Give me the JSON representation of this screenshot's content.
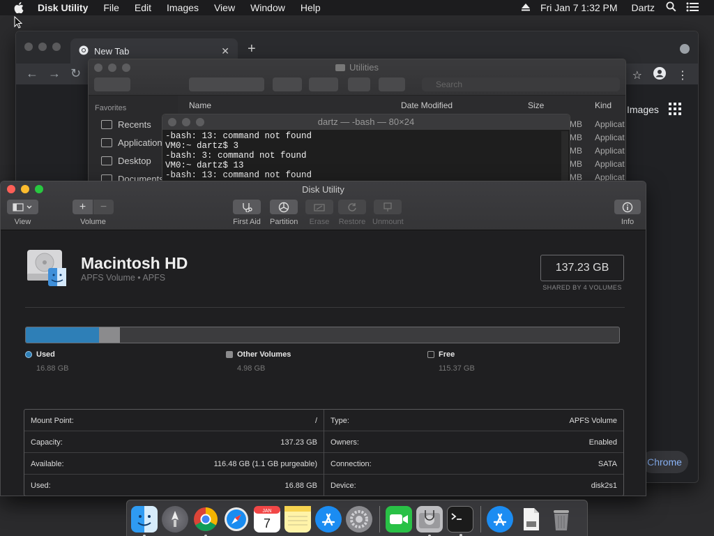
{
  "menubar": {
    "app_name": "Disk Utility",
    "menus": [
      "File",
      "Edit",
      "Images",
      "View",
      "Window",
      "Help"
    ],
    "clock": "Fri Jan 7  1:32 PM",
    "user": "Dartz"
  },
  "chrome": {
    "tab_title": "New Tab",
    "images_link": "Images",
    "chrome_pill": "Chrome"
  },
  "finder": {
    "title": "Utilities",
    "search_placeholder": "Search",
    "favorites_heading": "Favorites",
    "sidebar": [
      "Recents",
      "Applications",
      "Desktop",
      "Documents"
    ],
    "columns": {
      "name": "Name",
      "date": "Date Modified",
      "size": "Size",
      "kind": "Kind"
    },
    "rows": [
      {
        "size": "MB",
        "kind": "Applicat"
      },
      {
        "size": "MB",
        "kind": "Applicat"
      },
      {
        "size": "MB",
        "kind": "Applicat"
      },
      {
        "size": "MB",
        "kind": "Applicat"
      },
      {
        "size": "MB",
        "kind": "Applicat"
      }
    ]
  },
  "terminal": {
    "title": "dartz — -bash — 80×24",
    "lines": [
      "-bash: 13: command not found",
      "VM0:~ dartz$ 3",
      "-bash: 3: command not found",
      "VM0:~ dartz$ 13",
      "-bash: 13: command not found"
    ]
  },
  "disk_utility": {
    "title": "Disk Utility",
    "toolbar": {
      "view": "View",
      "volume": "Volume",
      "first_aid": "First Aid",
      "partition": "Partition",
      "erase": "Erase",
      "restore": "Restore",
      "unmount": "Unmount",
      "info": "Info"
    },
    "volume_name": "Macintosh HD",
    "volume_subtitle": "APFS Volume • APFS",
    "capacity_badge": "137.23 GB",
    "shared_label": "SHARED BY 4 VOLUMES",
    "usage": {
      "used_fraction": 0.123,
      "other_fraction": 0.036,
      "used_label": "Used",
      "used_value": "16.88 GB",
      "other_label": "Other Volumes",
      "other_value": "4.98 GB",
      "free_label": "Free",
      "free_value": "115.37 GB",
      "used_color": "#2e7fb7",
      "other_color": "#8b8b8d"
    },
    "info_left": [
      {
        "key": "Mount Point:",
        "value": "/"
      },
      {
        "key": "Capacity:",
        "value": "137.23 GB"
      },
      {
        "key": "Available:",
        "value": "116.48 GB (1.1 GB purgeable)"
      },
      {
        "key": "Used:",
        "value": "16.88 GB"
      }
    ],
    "info_right": [
      {
        "key": "Type:",
        "value": "APFS Volume"
      },
      {
        "key": "Owners:",
        "value": "Enabled"
      },
      {
        "key": "Connection:",
        "value": "SATA"
      },
      {
        "key": "Device:",
        "value": "disk2s1"
      }
    ]
  },
  "dock": {
    "icons": [
      "finder-icon",
      "launchpad-icon",
      "chrome-icon",
      "safari-icon",
      "calendar-icon",
      "notes-icon",
      "app-store-icon",
      "system-preferences-icon",
      "facetime-icon",
      "disk-utility-icon",
      "terminal-icon",
      "app-store-downloads-icon",
      "document-icon",
      "trash-icon"
    ],
    "calendar_month": "JAN",
    "calendar_day": "7"
  }
}
